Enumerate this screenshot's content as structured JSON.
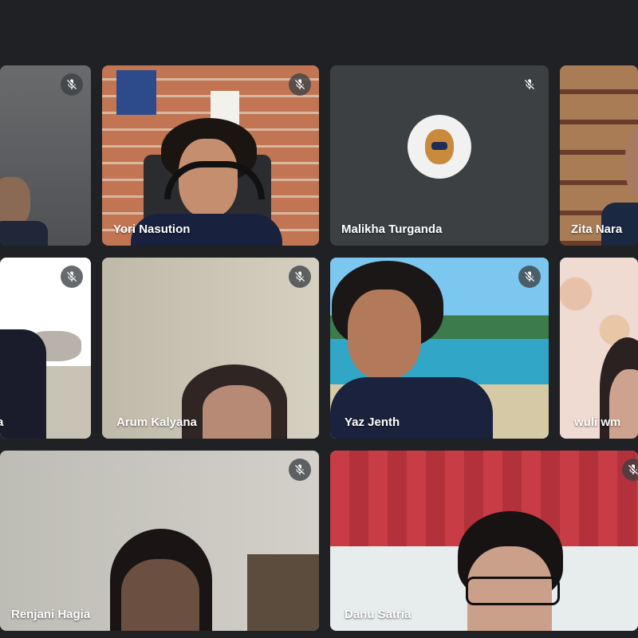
{
  "meeting": {
    "participants": [
      {
        "id": "p1",
        "name": "",
        "muted": true
      },
      {
        "id": "p2",
        "name": "Yori Nasution",
        "muted": true
      },
      {
        "id": "p3",
        "name": "Malikha Turganda",
        "muted": true
      },
      {
        "id": "p4",
        "name": "Zita Nara",
        "muted": false
      },
      {
        "id": "p5",
        "name": "a",
        "muted": true
      },
      {
        "id": "p6",
        "name": "Arum Kalyana",
        "muted": true
      },
      {
        "id": "p7",
        "name": "Yaz Jenth",
        "muted": true
      },
      {
        "id": "p8",
        "name": "wuli wm",
        "muted": false
      },
      {
        "id": "p9",
        "name": "Renjani Hagia",
        "muted": true
      },
      {
        "id": "p10",
        "name": "Danu Satria",
        "muted": true
      }
    ]
  },
  "icons": {
    "mic_off": "mic-off-icon"
  }
}
